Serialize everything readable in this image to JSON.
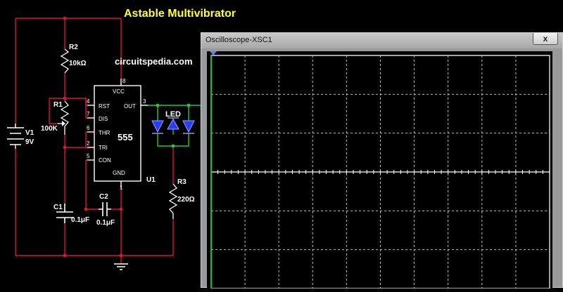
{
  "page": {
    "title": "Astable Multivibrator",
    "brand": "circuitspedia.com"
  },
  "schematic": {
    "ic": {
      "name": "U1",
      "type": "555",
      "pins": {
        "vcc": "VCC",
        "rst": "RST",
        "dis": "DIS",
        "thr": "THR",
        "tri": "TRI",
        "con": "CON",
        "out": "OUT",
        "gnd": "GND"
      },
      "pin_numbers": {
        "vcc": "8",
        "rst": "4",
        "dis": "7",
        "thr": "6",
        "tri": "2",
        "con": "5",
        "out": "3",
        "gnd": "1"
      }
    },
    "battery": {
      "name": "V1",
      "value": "9V"
    },
    "r2": {
      "name": "R2",
      "value": "10kΩ"
    },
    "r1": {
      "name": "R1",
      "value": "100K"
    },
    "r3": {
      "name": "R3",
      "value": "220Ω"
    },
    "c1": {
      "name": "C1",
      "value": "0.1μF"
    },
    "c2": {
      "name": "C2",
      "value": "0.1μF"
    },
    "led": {
      "label": "LED"
    },
    "colors": {
      "wire": "#d8182c",
      "node": "#d8182c",
      "led_wire": "#2ec632",
      "led": "#2a3cff",
      "component": "#ffffff"
    }
  },
  "oscilloscope": {
    "title": "Oscilloscope-XSC1",
    "close_label": "x",
    "trace_color": "#1ebe1e",
    "grid_divisions": {
      "x": 10,
      "y": 6
    }
  }
}
